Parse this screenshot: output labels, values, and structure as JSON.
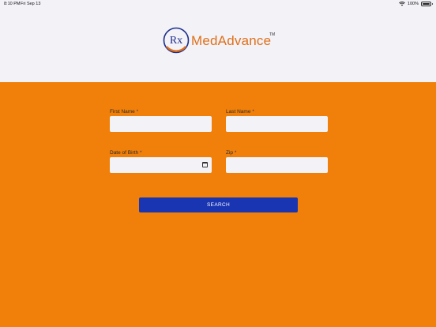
{
  "status_bar": {
    "time": "8:10 PM",
    "date": "Fri Sep 13",
    "battery": "100%"
  },
  "brand": {
    "mark": "Rx",
    "name": "MedAdvance",
    "trademark": "TM",
    "accent_color": "#E0701A"
  },
  "form": {
    "first_name": {
      "label": "First Name",
      "required": "*",
      "value": ""
    },
    "last_name": {
      "label": "Last Name",
      "required": "*",
      "value": ""
    },
    "dob": {
      "label": "Date of Birth",
      "required": "*",
      "value": "",
      "icon": "calendar-icon"
    },
    "zip": {
      "label": "Zip",
      "required": "*",
      "value": ""
    }
  },
  "search_button": {
    "label": "SEARCH",
    "color": "#1A35B2"
  },
  "colors": {
    "background": "#F1800A",
    "header": "#F2F2F7"
  }
}
